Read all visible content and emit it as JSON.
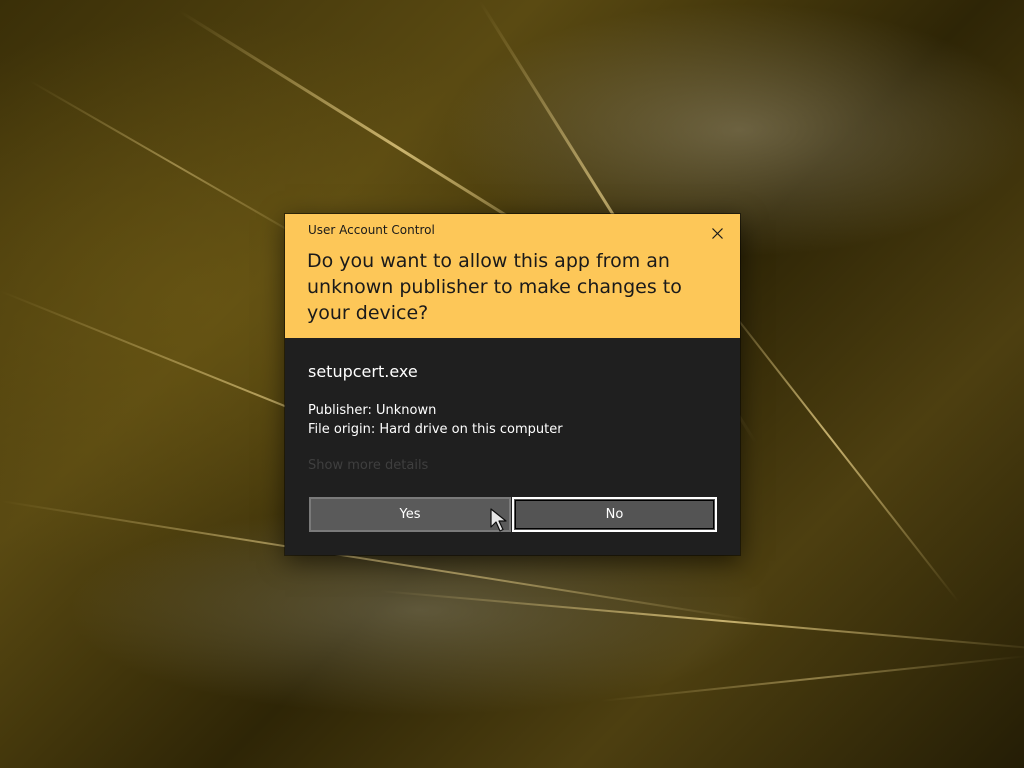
{
  "dialog": {
    "title": "User Account Control",
    "question": "Do you want to allow this app from an unknown publisher to make changes to your device?",
    "app_name": "setupcert.exe",
    "publisher": "Publisher: Unknown",
    "file_origin": "File origin: Hard drive on this computer",
    "show_more": "Show more details",
    "yes_label": "Yes",
    "no_label": "No"
  },
  "colors": {
    "header": "#fdc758",
    "body": "#1f1f1f",
    "button": "#575757"
  },
  "icons": {
    "close": "close-icon",
    "cursor": "mouse-pointer-icon"
  }
}
